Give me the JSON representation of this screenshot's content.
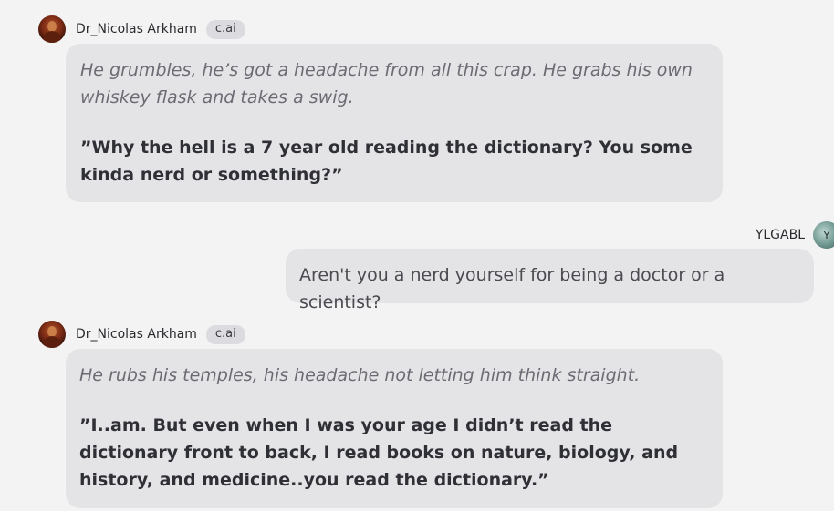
{
  "messages": [
    {
      "sender": "Dr_Nicolas Arkham",
      "badge": "c.ai",
      "action": "He grumbles, he’s got a headache from all this crap. He grabs his own whiskey flask and takes a swig.",
      "speech": "”Why the hell is a 7 year old reading the dictionary? You some kinda nerd or something?”"
    },
    {
      "sender": "YLGABL",
      "avatar_initial": "Y",
      "text": "Aren't you a nerd yourself for being a doctor or a scientist?"
    },
    {
      "sender": "Dr_Nicolas Arkham",
      "badge": "c.ai",
      "action": "He rubs his temples, his headache not letting him think straight.",
      "speech": "”I..am. But even when I was your age I didn’t read the dictionary front to back, I read books on nature, biology, and history, and medicine..you read the dictionary.”"
    }
  ],
  "icons": {
    "bot_avatar": "character-avatar-icon",
    "user_avatar": "user-avatar-icon"
  },
  "colors": {
    "background": "#f3f3f4",
    "bubble": "#e4e4e7",
    "badge": "#dcdce0",
    "action_text": "#6b6b73",
    "speech_text": "#2f3036"
  }
}
